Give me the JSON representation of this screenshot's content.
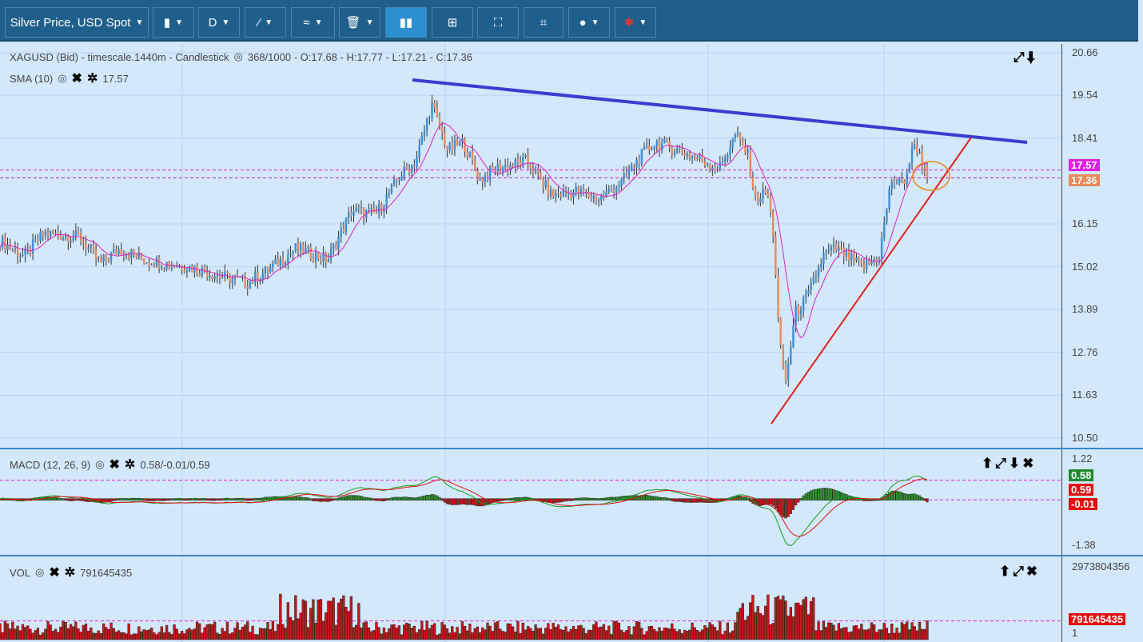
{
  "toolbar": {
    "symbol": "Silver Price, USD Spot",
    "timeframe": "D",
    "buttons": [
      "chart-type",
      "timeframe",
      "draw-line",
      "indicators",
      "delete",
      "volume",
      "layout",
      "fullscreen",
      "fit",
      "theme",
      "language"
    ]
  },
  "main": {
    "legend": "XAGUSD (Bid) - timescale.1440m - Candlestick",
    "count": "368/1000 - O:17.68 - H:17.77 - L:17.21 - C:17.36",
    "sma_label": "SMA (10)",
    "sma_value": "17.57",
    "axis_ticks": [
      "20.66",
      "19.54",
      "18.41",
      "16.15",
      "15.02",
      "13.89",
      "12.76",
      "11.63",
      "10.50"
    ],
    "sma_tag": "17.57",
    "close_tag": "17.36"
  },
  "macd": {
    "label": "MACD (12, 26, 9)",
    "values": "0.58/-0.01/0.59",
    "axis_top": "1.22",
    "axis_bottom": "-1.38",
    "tag_macd": "0.58",
    "tag_signal": "0.59",
    "tag_hist": "-0.01"
  },
  "vol": {
    "label": "VOL",
    "value": "791645435",
    "axis_top": "2973804356",
    "axis_bottom": "1",
    "tag": "791645435"
  },
  "chart_data": {
    "type": "candlestick",
    "symbol": "XAGUSD",
    "candles": 368,
    "last": {
      "open": 17.68,
      "high": 17.77,
      "low": 17.21,
      "close": 17.36
    },
    "sma10": 17.57,
    "ylim": [
      10.5,
      20.66
    ],
    "approx_close_path": [
      [
        0,
        15.7
      ],
      [
        30,
        15.3
      ],
      [
        55,
        15.9
      ],
      [
        100,
        15.8
      ],
      [
        125,
        15.1
      ],
      [
        150,
        15.5
      ],
      [
        180,
        15.2
      ],
      [
        240,
        15.0
      ],
      [
        270,
        14.8
      ],
      [
        310,
        14.6
      ],
      [
        340,
        15.0
      ],
      [
        370,
        15.5
      ],
      [
        410,
        15.2
      ],
      [
        440,
        16.5
      ],
      [
        470,
        16.4
      ],
      [
        500,
        17.4
      ],
      [
        520,
        17.8
      ],
      [
        540,
        19.3
      ],
      [
        560,
        18.1
      ],
      [
        580,
        18.3
      ],
      [
        600,
        17.3
      ],
      [
        620,
        17.6
      ],
      [
        660,
        17.8
      ],
      [
        690,
        16.9
      ],
      [
        720,
        17.0
      ],
      [
        750,
        16.8
      ],
      [
        780,
        17.3
      ],
      [
        800,
        17.9
      ],
      [
        820,
        18.3
      ],
      [
        860,
        18.0
      ],
      [
        900,
        17.6
      ],
      [
        920,
        18.5
      ],
      [
        935,
        18.0
      ],
      [
        945,
        16.8
      ],
      [
        960,
        17.0
      ],
      [
        968,
        15.8
      ],
      [
        975,
        13.0
      ],
      [
        983,
        12.0
      ],
      [
        995,
        13.8
      ],
      [
        1010,
        14.2
      ],
      [
        1030,
        15.3
      ],
      [
        1045,
        15.5
      ],
      [
        1080,
        15.0
      ],
      [
        1100,
        15.3
      ],
      [
        1115,
        17.3
      ],
      [
        1130,
        17.2
      ],
      [
        1145,
        18.3
      ],
      [
        1160,
        17.36
      ]
    ],
    "colors": {
      "up": "#3a8fd9",
      "down": "#e8895a",
      "sma": "#e020c0",
      "resistance": "#3b3bd0",
      "support": "#e02020"
    }
  }
}
